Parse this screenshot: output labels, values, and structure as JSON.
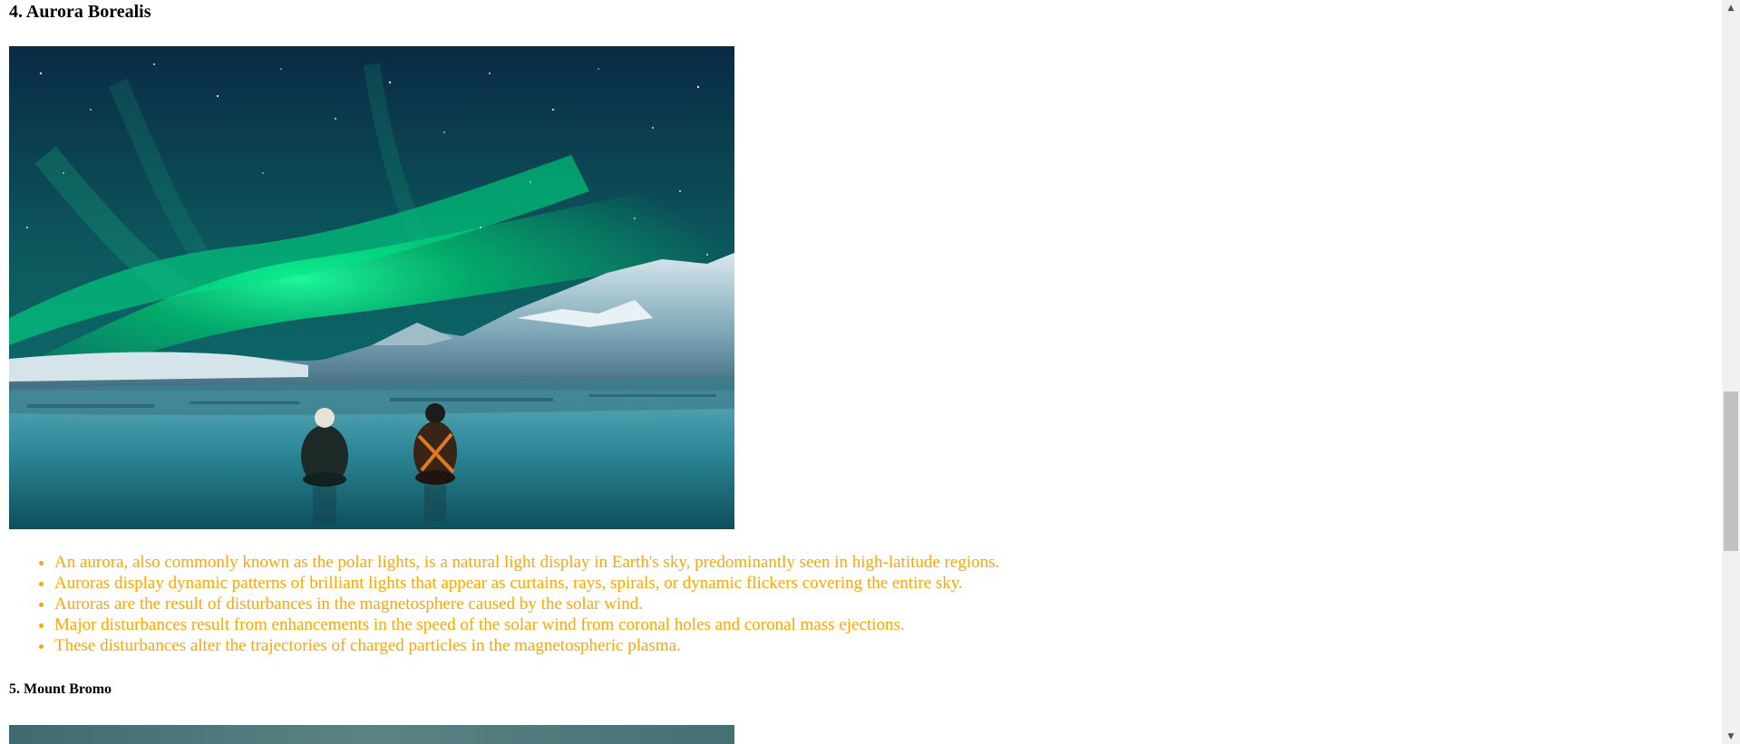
{
  "sections": [
    {
      "heading": "4. Aurora Borealis",
      "image": {
        "subject": "aurora borealis over icy landscape with two people sitting",
        "colors": {
          "sky_top": "#0b2f4a",
          "aurora": "#00d97e",
          "ice": "#3e8fa3",
          "snow": "#cfe3ea"
        }
      },
      "facts": [
        "An aurora, also commonly known as the polar lights, is a natural light display in Earth's sky, predominantly seen in high-latitude regions.",
        "Auroras display dynamic patterns of brilliant lights that appear as curtains, rays, spirals, or dynamic flickers covering the entire sky.",
        "Auroras are the result of disturbances in the magnetosphere caused by the solar wind.",
        "Major disturbances result from enhancements in the speed of the solar wind from coronal holes and coronal mass ejections.",
        "These disturbances alter the trajectories of charged particles in the magnetospheric plasma."
      ]
    },
    {
      "heading": "5. Mount Bromo",
      "image": {
        "subject": "top edge of a landscape photo of Mount Bromo",
        "colors": {
          "sky": "#4e7377"
        }
      }
    }
  ],
  "style": {
    "list_color": "#ffa500",
    "heading_color": "#000000"
  },
  "scrollbar": {
    "up_arrow_icon": "▲",
    "down_arrow_icon": "▼"
  }
}
